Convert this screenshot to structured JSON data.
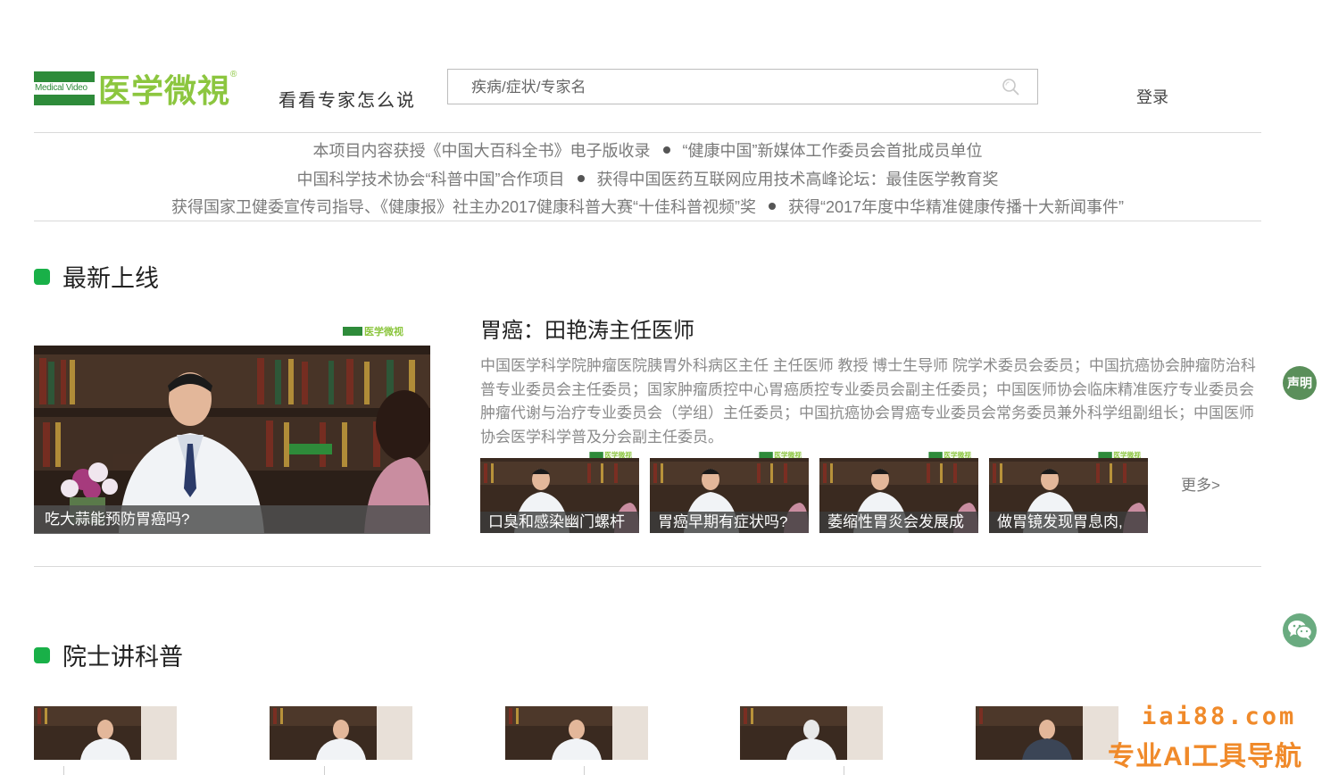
{
  "header": {
    "logo_en": "Medical Video",
    "logo_cn": "医学微視",
    "logo_reg": "®",
    "tagline": "看看专家怎么说",
    "search_placeholder": "疾病/症状/专家名",
    "login_label": "登录"
  },
  "announcements": [
    {
      "left": "本项目内容获授《中国大百科全书》电子版收录",
      "right": "“健康中国”新媒体工作委员会首批成员单位"
    },
    {
      "left": "中国科学技术协会“科普中国”合作项目",
      "right": "获得中国医药互联网应用技术高峰论坛：最佳医学教育奖"
    },
    {
      "left": "获得国家卫健委宣传司指导、《健康报》社主办2017健康科普大赛“十佳科普视频”奖",
      "right": "获得“2017年度中华精准健康传播十大新闻事件”"
    }
  ],
  "sections": {
    "latest_title": "最新上线",
    "academician_title": "院士讲科普"
  },
  "featured": {
    "mini_logo": "医学微视",
    "caption_overlay": "吃大蒜能预防胃癌吗?",
    "doctor_title": "胃癌：田艳涛主任医师",
    "doctor_desc": "中国医学科学院肿瘤医院胰胃外科病区主任 主任医师 教授 博士生导师 院学术委员会委员；中国抗癌协会肿瘤防治科普专业委员会主任委员；国家肿瘤质控中心胃癌质控专业委员会副主任委员；中国医师协会临床精准医疗专业委员会肿瘤代谢与治疗专业委员会（学组）主任委员；中国抗癌协会胃癌专业委员会常务委员兼外科学组副组长；中国医师协会医学科学普及分会副主任委员。"
  },
  "thumbs": [
    {
      "caption": "口臭和感染幽门螺杆"
    },
    {
      "caption": "胃癌早期有症状吗?"
    },
    {
      "caption": "萎缩性胃炎会发展成"
    },
    {
      "caption": "做胃镜发现胃息肉,"
    }
  ],
  "more_label": "更多>",
  "floaters": {
    "statement_label": "声明"
  },
  "watermark": {
    "line1": "iai88.com",
    "line2": "专业AI工具导航"
  },
  "colors": {
    "brand_green": "#19b048",
    "logo_light_green": "#8cc63f",
    "watermark_orange": "#f08a2a"
  }
}
